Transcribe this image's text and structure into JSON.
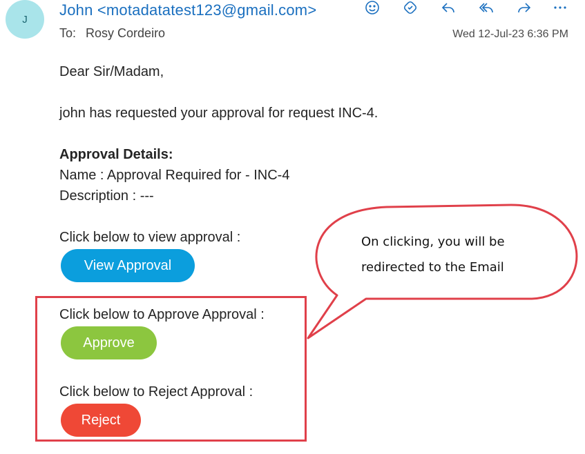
{
  "header": {
    "avatar_initial": "J",
    "sender": "John <motadatatest123@gmail.com>",
    "to_label": "To:",
    "recipient": "Rosy Cordeiro",
    "timestamp": "Wed 12-Jul-23 6:36 PM",
    "toolbar": [
      {
        "icon": "emoji-icon"
      },
      {
        "icon": "sticker-icon"
      },
      {
        "icon": "reply-icon"
      },
      {
        "icon": "reply-all-icon"
      },
      {
        "icon": "forward-icon"
      },
      {
        "icon": "more-icon"
      }
    ]
  },
  "body": {
    "greeting": "Dear Sir/Madam,",
    "request_line": "john has requested your approval for request INC-4.",
    "details_heading": "Approval Details:",
    "name_line": "Name : Approval Required for - INC-4",
    "description_line": "Description : ---",
    "view_prompt": "Click below to view approval :",
    "view_button": "View Approval",
    "approve_prompt": "Click below to Approve Approval :",
    "approve_button": "Approve",
    "reject_prompt": "Click below to Reject Approval :",
    "reject_button": "Reject"
  },
  "callout": {
    "line1": "On clicking, you will be",
    "line2": "redirected to the Email"
  },
  "colors": {
    "link_blue": "#1a6fbf",
    "view_button": "#0b9edd",
    "approve_button": "#8cc63f",
    "reject_button": "#ef4836",
    "annotation_red": "#e0404a"
  }
}
